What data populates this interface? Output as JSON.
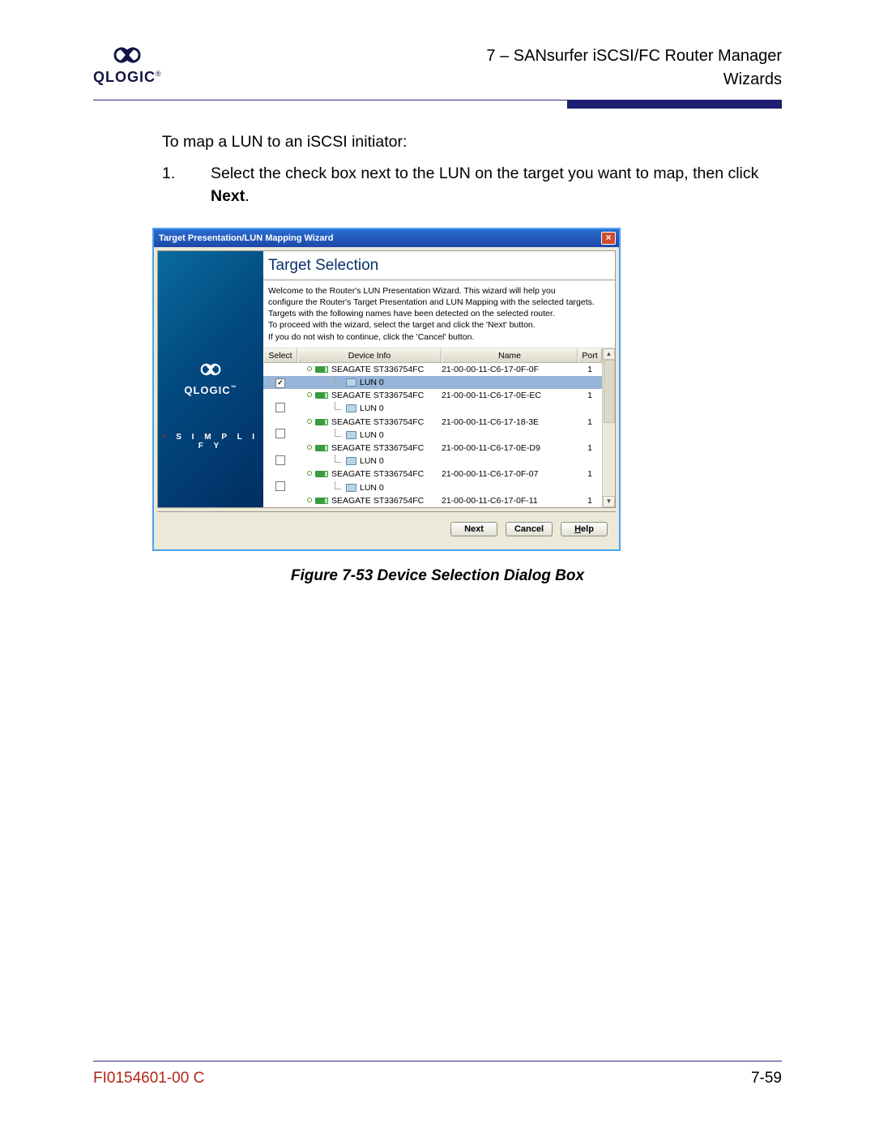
{
  "header": {
    "brand": "QLOGIC",
    "section_line1": "7 – SANsurfer iSCSI/FC Router Manager",
    "section_line2": "Wizards"
  },
  "intro": "To map a LUN to an iSCSI initiator:",
  "step": {
    "num": "1.",
    "text_before": "Select the check box next to the LUN on the target you want to map, then click ",
    "bold": "Next",
    "text_after": "."
  },
  "dialog": {
    "title": "Target Presentation/LUN Mapping Wizard",
    "panel_title": "Target Selection",
    "intro_lines": [
      "Welcome to the Router's LUN Presentation Wizard.  This wizard will help you",
      "configure the Router's Target Presentation and LUN Mapping with the selected targets.",
      "Targets with the following names have been detected on the selected router.",
      "To proceed with the wizard, select the target and click the 'Next' button.",
      "If you do not wish to continue, click the 'Cancel' button."
    ],
    "columns": {
      "select": "Select",
      "info": "Device Info",
      "name": "Name",
      "port": "Port"
    },
    "rows": [
      {
        "type": "target",
        "checked": false,
        "device": "SEAGATE ST336754FC",
        "name": "21-00-00-11-C6-17-0F-0F",
        "port": "1"
      },
      {
        "type": "lun",
        "checked": true,
        "selected": true,
        "lun": "LUN 0"
      },
      {
        "type": "target",
        "checked": false,
        "device": "SEAGATE ST336754FC",
        "name": "21-00-00-11-C6-17-0E-EC",
        "port": "1"
      },
      {
        "type": "lun",
        "checked": false,
        "lun": "LUN 0"
      },
      {
        "type": "target",
        "checked": false,
        "device": "SEAGATE ST336754FC",
        "name": "21-00-00-11-C6-17-18-3E",
        "port": "1"
      },
      {
        "type": "lun",
        "checked": false,
        "lun": "LUN 0"
      },
      {
        "type": "target",
        "checked": false,
        "device": "SEAGATE ST336754FC",
        "name": "21-00-00-11-C6-17-0E-D9",
        "port": "1"
      },
      {
        "type": "lun",
        "checked": false,
        "lun": "LUN 0"
      },
      {
        "type": "target",
        "checked": false,
        "device": "SEAGATE ST336754FC",
        "name": "21-00-00-11-C6-17-0F-07",
        "port": "1"
      },
      {
        "type": "lun",
        "checked": false,
        "lun": "LUN 0"
      },
      {
        "type": "target",
        "checked": false,
        "device": "SEAGATE ST336754FC",
        "name": "21-00-00-11-C6-17-0F-11",
        "port": "1"
      }
    ],
    "buttons": {
      "next": "Next",
      "cancel": "Cancel",
      "help_u": "H",
      "help_rest": "elp"
    },
    "side": {
      "brand": "QLOGIC",
      "tagline": "S I M P L I F Y"
    }
  },
  "caption": "Figure 7-53  Device Selection Dialog Box",
  "footer": {
    "docnum": "FI0154601-00  C",
    "page": "7-59"
  }
}
